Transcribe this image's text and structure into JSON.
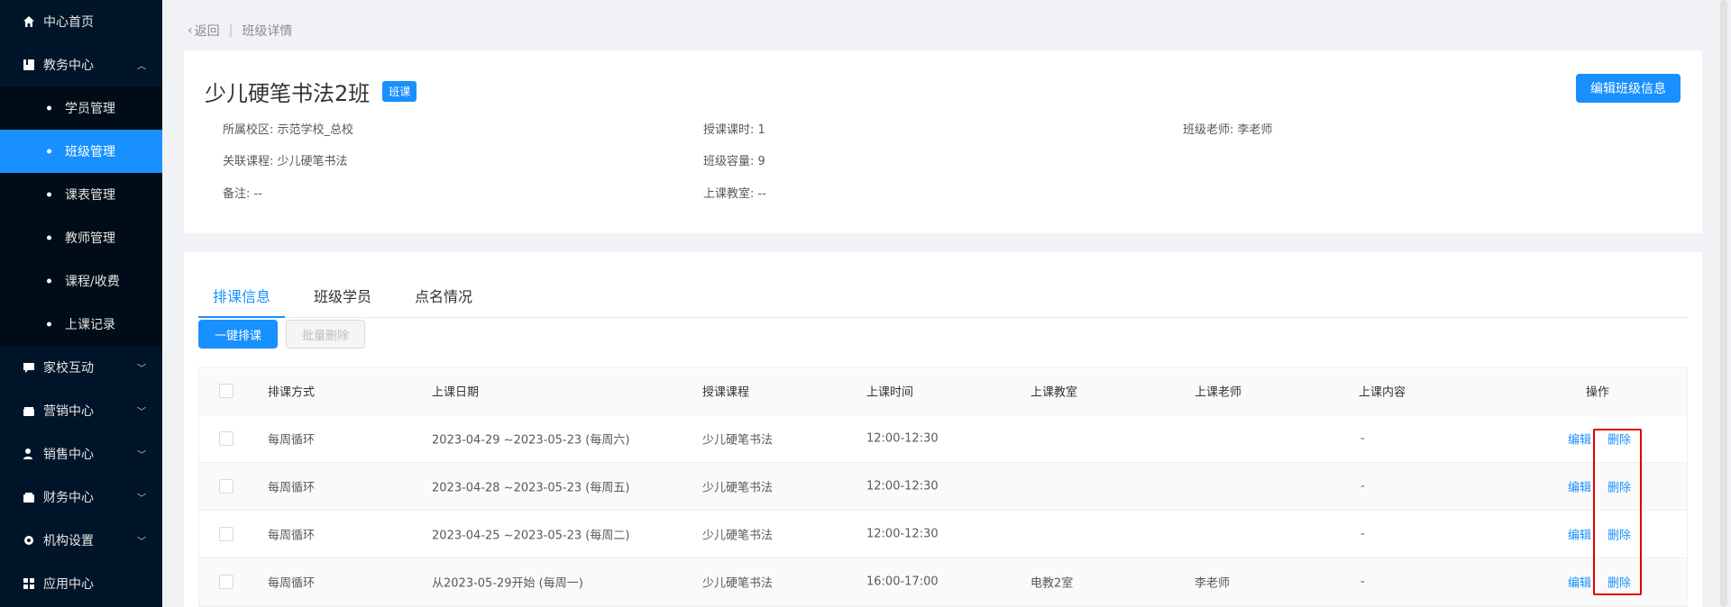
{
  "sidebar": {
    "items": [
      {
        "label": "中心首页",
        "icon": "home-icon"
      },
      {
        "label": "教务中心",
        "icon": "book-icon",
        "expanded": true
      },
      {
        "label": "家校互动",
        "icon": "chat-icon"
      },
      {
        "label": "营销中心",
        "icon": "gift-icon"
      },
      {
        "label": "销售中心",
        "icon": "user-icon"
      },
      {
        "label": "财务中心",
        "icon": "wallet-icon"
      },
      {
        "label": "机构设置",
        "icon": "gear-icon"
      },
      {
        "label": "应用中心",
        "icon": "apps-icon"
      }
    ],
    "subitems": [
      "学员管理",
      "班级管理",
      "课表管理",
      "教师管理",
      "课程/收费",
      "上课记录"
    ]
  },
  "breadcrumb": {
    "back": "返回",
    "sep": "|",
    "current": "班级详情"
  },
  "class": {
    "title": "少儿硬笔书法2班",
    "tag": "班课",
    "edit_button": "编辑班级信息",
    "campus": "所属校区: 示范学校_总校",
    "course": "关联课程: 少儿硬笔书法",
    "note": "备注: --",
    "hours": "授课课时: 1",
    "capacity": "班级容量: 9",
    "classroom": "上课教室: --",
    "teacher": "班级老师:  李老师"
  },
  "tabs": [
    "排课信息",
    "班级学员",
    "点名情况"
  ],
  "actions": {
    "schedule": "一键排课",
    "batch_delete": "批量删除"
  },
  "table": {
    "headers": [
      "排课方式",
      "上课日期",
      "授课课程",
      "上课时间",
      "上课教室",
      "上课老师",
      "上课内容",
      "操作"
    ],
    "rows": [
      {
        "mode": "每周循环",
        "date": "2023-04-29 ~2023-05-23 (每周六)",
        "course": "少儿硬笔书法",
        "time": "12:00-12:30",
        "room": "",
        "teacher": "",
        "content": "-",
        "edit": "编辑",
        "delete": "删除"
      },
      {
        "mode": "每周循环",
        "date": "2023-04-28 ~2023-05-23 (每周五)",
        "course": "少儿硬笔书法",
        "time": "12:00-12:30",
        "room": "",
        "teacher": "",
        "content": "-",
        "edit": "编辑",
        "delete": "删除"
      },
      {
        "mode": "每周循环",
        "date": "2023-04-25 ~2023-05-23 (每周二)",
        "course": "少儿硬笔书法",
        "time": "12:00-12:30",
        "room": "",
        "teacher": "",
        "content": "-",
        "edit": "编辑",
        "delete": "删除"
      },
      {
        "mode": "每周循环",
        "date": "从2023-05-29开始 (每周一)",
        "course": "少儿硬笔书法",
        "time": "16:00-17:00",
        "room": "电教2室",
        "teacher": "李老师",
        "content": "-",
        "edit": "编辑",
        "delete": "删除"
      }
    ]
  },
  "colors": {
    "sidebar_bg": "#001529",
    "accent": "#1890ff",
    "highlight": "#e00000"
  }
}
